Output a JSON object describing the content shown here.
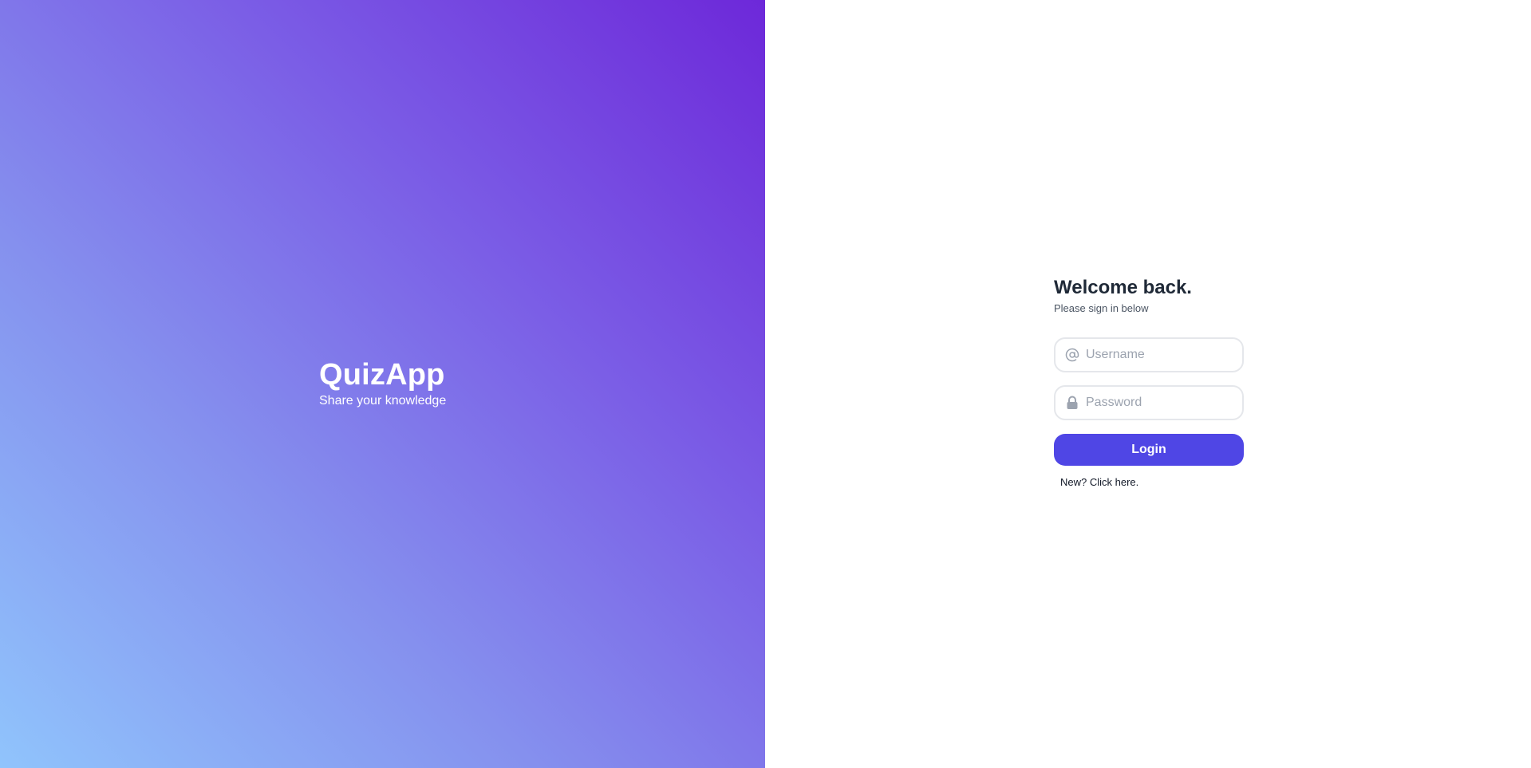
{
  "hero": {
    "title": "QuizApp",
    "tagline": "Share your knowledge"
  },
  "login": {
    "title": "Welcome back.",
    "subtitle": "Please sign in below",
    "username": {
      "placeholder": "Username",
      "value": "",
      "icon": "at-sign-icon"
    },
    "password": {
      "placeholder": "Password",
      "value": "",
      "icon": "lock-icon"
    },
    "submit_label": "Login",
    "signup_link": "New? Click here."
  },
  "colors": {
    "primary": "#4f46e5",
    "gradient_start": "#90c4fc",
    "gradient_end": "#6d28d9",
    "heading": "#1f2937",
    "input_border": "#e5e7eb"
  }
}
